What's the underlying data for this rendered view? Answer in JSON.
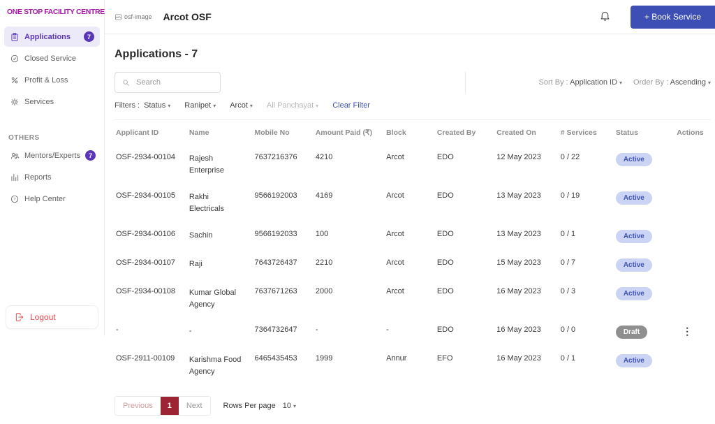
{
  "colors": {
    "brand_magenta": "#A31AA5",
    "accent_purple": "#5A36B8",
    "accent_indigo": "#3D4EB5",
    "active_pill_bg": "#CBD4F5",
    "active_pill_text": "#3F51B5",
    "draft_pill_bg": "#8F8F8F",
    "pagination_active": "#9D2433",
    "logout_red": "#E5484D"
  },
  "icons": {
    "caret": "▾",
    "kebab": "⋮"
  },
  "sidebar": {
    "brand": "ONE STOP FACILITY CENTRE",
    "items": [
      {
        "label": "Applications",
        "badge": "7"
      },
      {
        "label": "Closed Service"
      },
      {
        "label": "Profit & Loss"
      },
      {
        "label": "Services"
      }
    ],
    "others_heading": "OTHERS",
    "others": [
      {
        "label": "Mentors/Experts",
        "badge": "7"
      },
      {
        "label": "Reports"
      },
      {
        "label": "Help Center"
      }
    ],
    "logout": "Logout"
  },
  "header": {
    "logo_text": "osf-image",
    "title": "Arcot OSF",
    "book_service": "+ Book Service"
  },
  "main": {
    "heading": "Applications -",
    "heading_count": "7",
    "search_placeholder": "Search",
    "filters": {
      "label": "Filters :",
      "status": "Status",
      "district": "Ranipet",
      "block": "Arcot",
      "panchayat": "All Panchayat",
      "clear": "Clear Filter"
    },
    "sort": {
      "sort_by_label": "Sort By :",
      "sort_by_value": "Application ID",
      "order_by_label": "Order By :",
      "order_by_value": "Ascending"
    },
    "table": {
      "columns": [
        "Applicant ID",
        "Name",
        "Mobile No",
        "Amount Paid (₹)",
        "Block",
        "Created By",
        "Created On",
        "# Services",
        "Status",
        "Actions"
      ],
      "rows": [
        {
          "applicant_id": "OSF-2934-00104",
          "name": "Rajesh Enterprise",
          "mobile_no": "7637216376",
          "amount_paid": "4210",
          "block": "Arcot",
          "created_by": "EDO",
          "created_on": "12 May 2023",
          "services": "0 / 22",
          "status": "Active",
          "has_actions_menu": false
        },
        {
          "applicant_id": "OSF-2934-00105",
          "name": "Rakhi Electricals",
          "mobile_no": "9566192003",
          "amount_paid": "4169",
          "block": "Arcot",
          "created_by": "EDO",
          "created_on": "13 May 2023",
          "services": "0 / 19",
          "status": "Active",
          "has_actions_menu": false
        },
        {
          "applicant_id": "OSF-2934-00106",
          "name": "Sachin",
          "mobile_no": "9566192033",
          "amount_paid": "100",
          "block": "Arcot",
          "created_by": "EDO",
          "created_on": "13 May 2023",
          "services": "0 / 1",
          "status": "Active",
          "has_actions_menu": false
        },
        {
          "applicant_id": "OSF-2934-00107",
          "name": "Raji",
          "mobile_no": "7643726437",
          "amount_paid": "2210",
          "block": "Arcot",
          "created_by": "EDO",
          "created_on": "15 May 2023",
          "services": "0 / 7",
          "status": "Active",
          "has_actions_menu": false
        },
        {
          "applicant_id": "OSF-2934-00108",
          "name": "Kumar Global Agency",
          "mobile_no": "7637671263",
          "amount_paid": "2000",
          "block": "Arcot",
          "created_by": "EDO",
          "created_on": "16 May 2023",
          "services": "0 / 3",
          "status": "Active",
          "has_actions_menu": false
        },
        {
          "applicant_id": "-",
          "name": "-",
          "mobile_no": "7364732647",
          "amount_paid": "-",
          "block": "-",
          "created_by": "EDO",
          "created_on": "16 May 2023",
          "services": "0 / 0",
          "status": "Draft",
          "has_actions_menu": true
        },
        {
          "applicant_id": "OSF-2911-00109",
          "name": "Karishma Food Agency",
          "mobile_no": "6465435453",
          "amount_paid": "1999",
          "block": "Annur",
          "created_by": "EFO",
          "created_on": "16 May 2023",
          "services": "0 / 1",
          "status": "Active",
          "has_actions_menu": false
        }
      ]
    },
    "pagination": {
      "previous": "Previous",
      "current_page": "1",
      "next": "Next",
      "rows_label": "Rows Per page",
      "rows_value": "10"
    }
  }
}
